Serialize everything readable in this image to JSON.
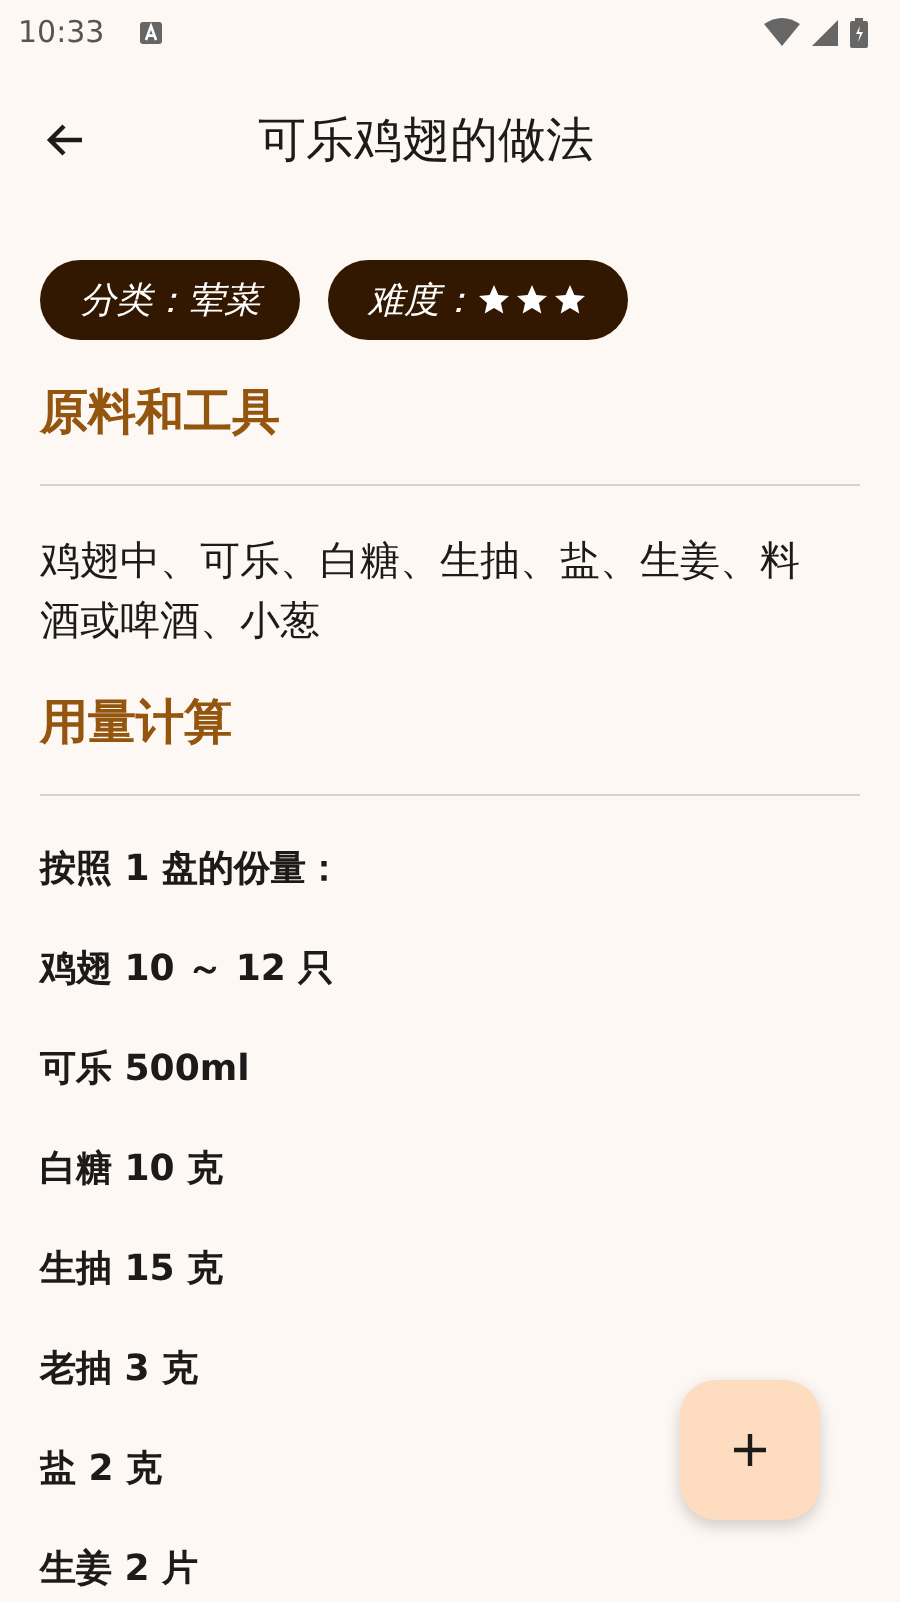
{
  "status_bar": {
    "time": "10:33"
  },
  "app_bar": {
    "title": "可乐鸡翅的做法"
  },
  "chips": [
    {
      "kind": "text",
      "label": "分类：",
      "value": "荤菜"
    },
    {
      "kind": "stars",
      "label": "难度：",
      "stars": 3
    }
  ],
  "sections": [
    {
      "heading": "原料和工具",
      "kind": "paragraph",
      "text": "鸡翅中、可乐、白糖、生抽、盐、生姜、料酒或啤酒、小葱"
    },
    {
      "heading": "用量计算",
      "kind": "list",
      "items": [
        "按照 1 盘的份量：",
        "鸡翅 10 ～ 12 只",
        "可乐 500ml",
        "白糖 10 克",
        "生抽 15 克",
        "老抽 3 克",
        "盐 2 克",
        "生姜 2 片"
      ]
    }
  ]
}
